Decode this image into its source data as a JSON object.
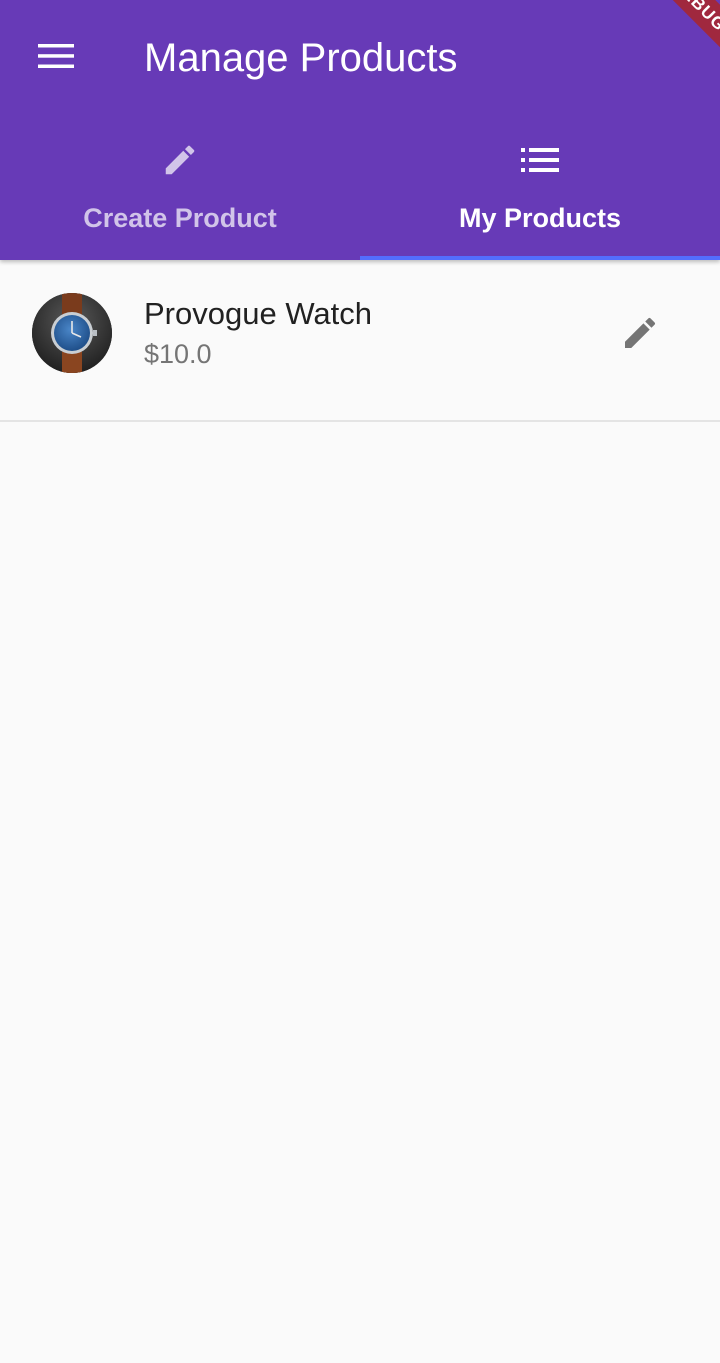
{
  "app_bar": {
    "title": "Manage Products",
    "background_color": "#673ab7",
    "menu_icon": "hamburger-menu-icon"
  },
  "debug_banner": {
    "text": "DEBUG",
    "color": "#a0283e"
  },
  "tabs": [
    {
      "label": "Create Product",
      "icon": "edit-pencil-icon",
      "selected": false
    },
    {
      "label": "My Products",
      "icon": "list-icon",
      "selected": true
    }
  ],
  "tab_indicator_color": "#536dfe",
  "products": [
    {
      "name": "Provogue Watch",
      "price": "$10.0",
      "image": "watch-thumbnail",
      "action_icon": "edit-pencil-icon"
    }
  ]
}
